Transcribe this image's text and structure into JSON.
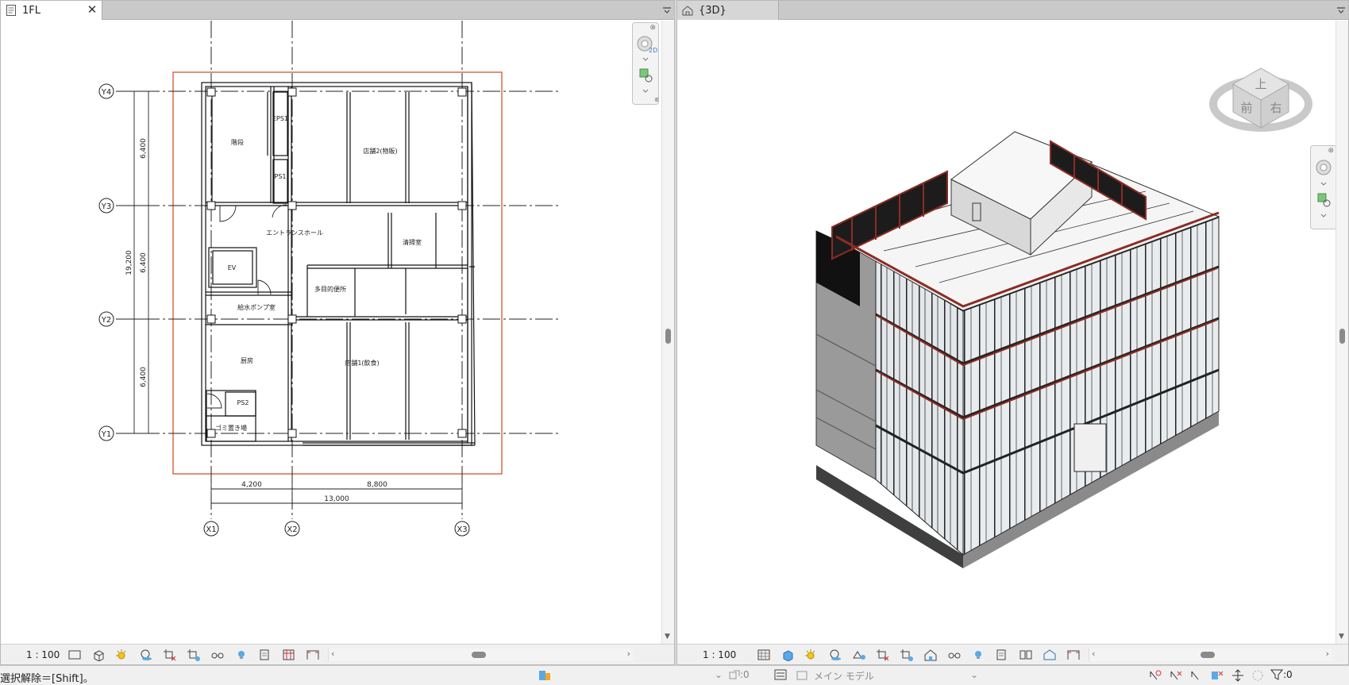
{
  "left_view": {
    "tab_title": "1FL",
    "scale": "1 : 100",
    "plan": {
      "grid_y": [
        "Y4",
        "Y3",
        "Y2",
        "Y1"
      ],
      "grid_x": [
        "X1",
        "X2",
        "X3"
      ],
      "dims_vertical": [
        "6,400",
        "6,400",
        "6,400"
      ],
      "dim_vertical_total": "19,200",
      "dims_horizontal": [
        "4,200",
        "8,800"
      ],
      "dim_horizontal_total": "13,000",
      "rooms": {
        "stairs": "階段",
        "eps1": "EPS1",
        "ps1": "PS1",
        "shop2": "店舗2(物販)",
        "entrance_hall": "エントランスホール",
        "cleaning_room": "清掃室",
        "ev": "EV",
        "multipurpose_toilet": "多目的便所",
        "water_pump_room": "給水ポンプ室",
        "kitchen": "厨房",
        "shop1": "店舗1(飲食)",
        "ps2": "PS2",
        "garbage_area": "ゴミ置き場"
      }
    }
  },
  "right_view": {
    "tab_title": "{3D}",
    "scale": "1 : 100",
    "viewcube": {
      "top": "上",
      "front": "前",
      "right": "右"
    }
  },
  "status": {
    "message": "選択解除＝[Shift]。",
    "worksharing_count": ":0",
    "model": "メイン モデル",
    "filter_count": ":0"
  },
  "colors": {
    "crop_region": "#d9532a",
    "steel_accent": "#8c2c24",
    "tab_bg": "#c9c9c9"
  }
}
